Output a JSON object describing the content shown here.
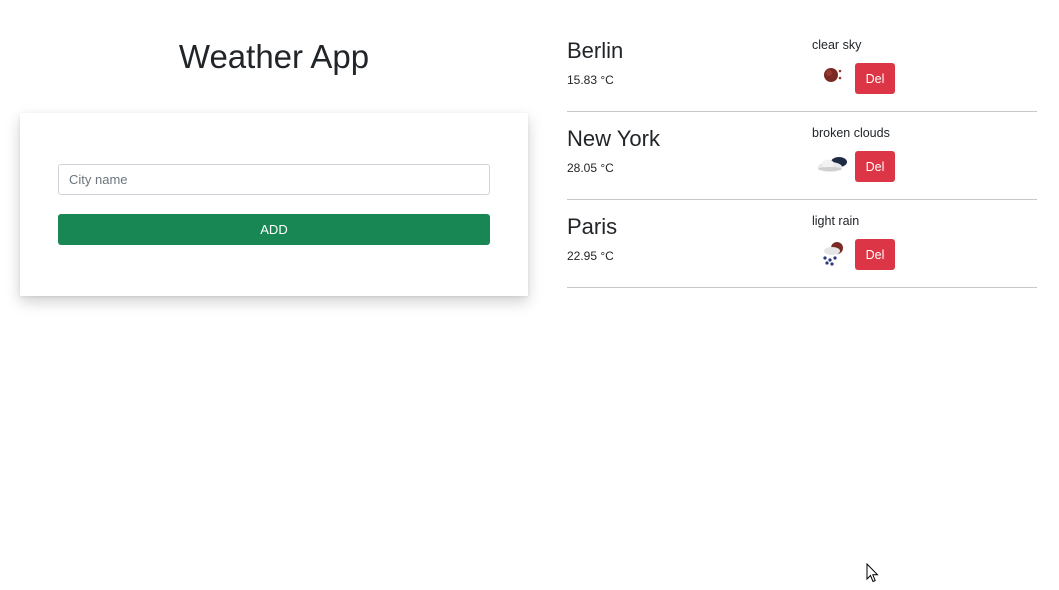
{
  "app": {
    "title": "Weather App"
  },
  "form": {
    "city_input_placeholder": "City name",
    "city_input_value": "",
    "add_label": "ADD"
  },
  "cities": [
    {
      "name": "Berlin",
      "temperature": "15.83 °C",
      "description": "clear sky",
      "icon": "clear-sky-night-icon",
      "delete_label": "Del"
    },
    {
      "name": "New York",
      "temperature": "28.05 °C",
      "description": "broken clouds",
      "icon": "broken-clouds-icon",
      "delete_label": "Del"
    },
    {
      "name": "Paris",
      "temperature": "22.95 °C",
      "description": "light rain",
      "icon": "light-rain-night-icon",
      "delete_label": "Del"
    }
  ],
  "colors": {
    "add_button": "#198754",
    "delete_button": "#dc3545",
    "divider": "#c8c8c8"
  }
}
